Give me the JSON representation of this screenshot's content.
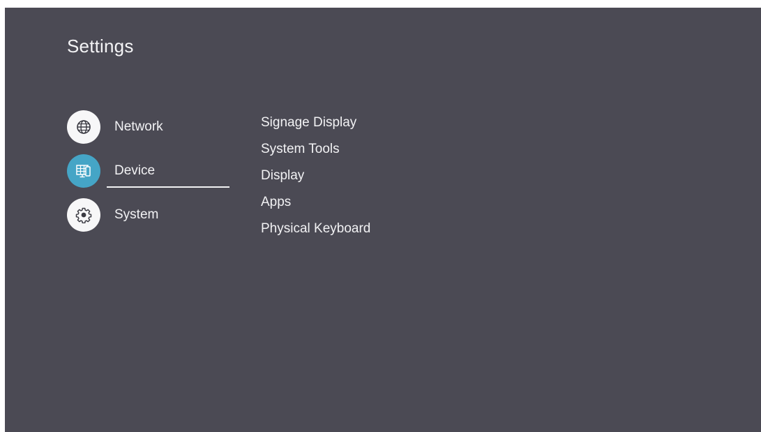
{
  "header": {
    "title": "Settings"
  },
  "categories": [
    {
      "label": "Network",
      "icon": "globe-icon",
      "active": false
    },
    {
      "label": "Device",
      "icon": "device-display-icon",
      "active": true
    },
    {
      "label": "System",
      "icon": "gear-icon",
      "active": false
    }
  ],
  "device_menu": {
    "items": [
      {
        "label": "Signage Display"
      },
      {
        "label": "System Tools"
      },
      {
        "label": "Display"
      },
      {
        "label": "Apps"
      },
      {
        "label": "Physical Keyboard"
      }
    ]
  },
  "colors": {
    "background": "#4b4a54",
    "accent": "#45a5c6",
    "icon_circle": "#f7f7f8",
    "text": "#f2f2f4"
  }
}
